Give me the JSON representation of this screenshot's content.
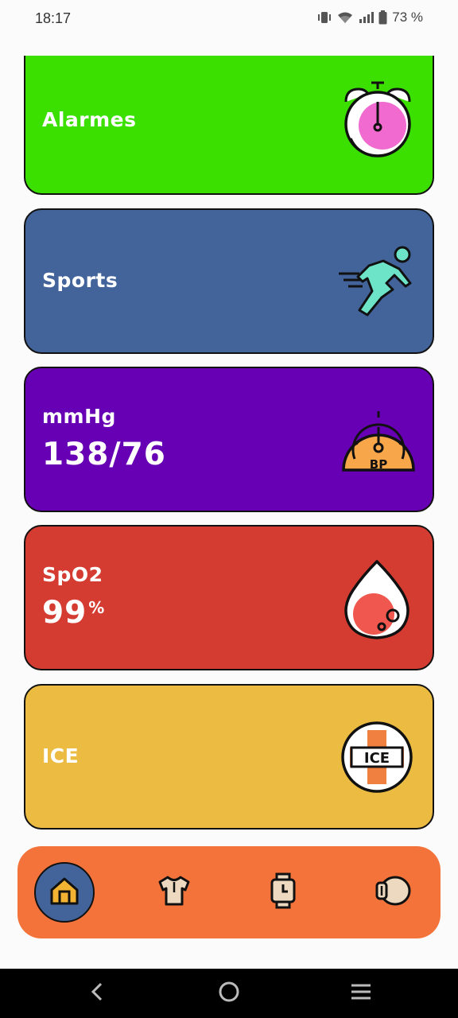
{
  "status_bar": {
    "time": "18:17",
    "battery_text": "73 %",
    "icons": [
      "vibrate-icon",
      "wifi-icon",
      "signal-icon",
      "battery-icon"
    ]
  },
  "cards": {
    "alarmes": {
      "label": "Alarmes",
      "color": "#3bdf00",
      "icon": "stopwatch-icon"
    },
    "sports": {
      "label": "Sports",
      "color": "#42649a",
      "icon": "runner-icon"
    },
    "bp": {
      "label": "mmHg",
      "value": "138/76",
      "color": "#6700b4",
      "icon": "blood-pressure-gauge-icon",
      "icon_text": "BP"
    },
    "spo2": {
      "label": "SpO2",
      "value": "99",
      "unit": "%",
      "color": "#d43b31",
      "icon": "blood-drop-icon"
    },
    "ice": {
      "label": "ICE",
      "color": "#ecbc42",
      "icon": "ice-badge-icon",
      "icon_text": "ICE"
    }
  },
  "bottom_nav": {
    "color": "#f3733a",
    "items": [
      {
        "name": "home",
        "icon": "home-icon",
        "active": true
      },
      {
        "name": "shirt",
        "icon": "shirt-icon",
        "active": false
      },
      {
        "name": "watch",
        "icon": "watch-icon",
        "active": false
      },
      {
        "name": "pod",
        "icon": "pod-icon",
        "active": false
      }
    ]
  },
  "system_nav": [
    "back-icon",
    "home-circle-icon",
    "recents-icon"
  ]
}
